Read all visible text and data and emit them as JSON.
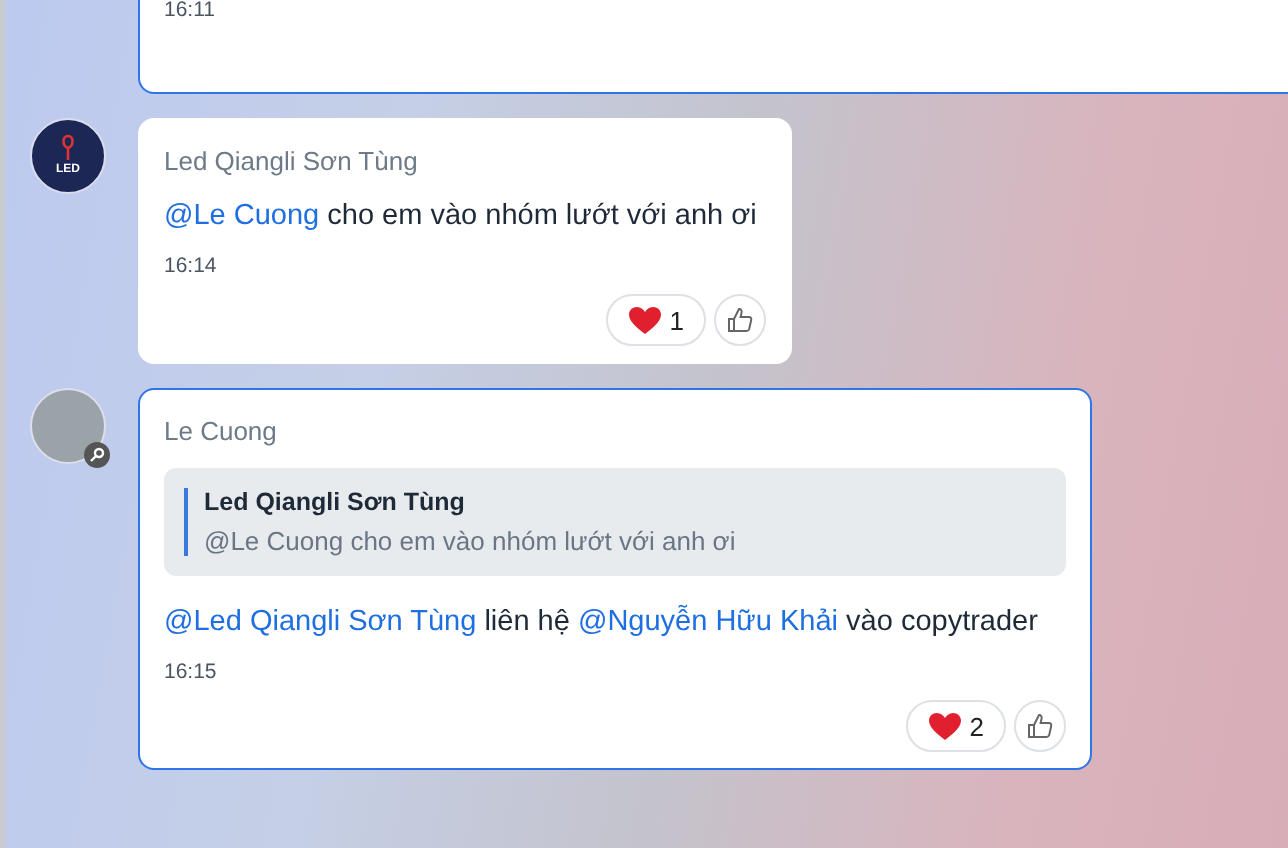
{
  "messages": [
    {
      "highlighted": true,
      "time": "16:11"
    },
    {
      "highlighted": false,
      "avatar": {
        "kind": "logo",
        "text": "LED"
      },
      "author": "Led Qiangli Sơn Tùng",
      "parts": [
        {
          "kind": "mention",
          "text": "@Le Cuong"
        },
        {
          "kind": "text",
          "text": "cho em vào nhóm lướt với anh ơi"
        }
      ],
      "time": "16:14",
      "reactions": [
        {
          "count": "1"
        }
      ]
    },
    {
      "highlighted": true,
      "avatar": {
        "kind": "photo",
        "badge": true
      },
      "author": "Le Cuong",
      "quote": {
        "author": "Led Qiangli Sơn Tùng",
        "text": "@Le Cuong cho em vào nhóm lướt với anh ơi"
      },
      "parts": [
        {
          "kind": "mention",
          "text": "@Led Qiangli Sơn Tùng"
        },
        {
          "kind": "text",
          "text": "liên hệ"
        },
        {
          "kind": "mention",
          "text": "@Nguyễn Hữu Khải"
        },
        {
          "kind": "text",
          "text": "vào copytrader"
        }
      ],
      "time": "16:15",
      "reactions": [
        {
          "count": "2"
        }
      ]
    }
  ]
}
